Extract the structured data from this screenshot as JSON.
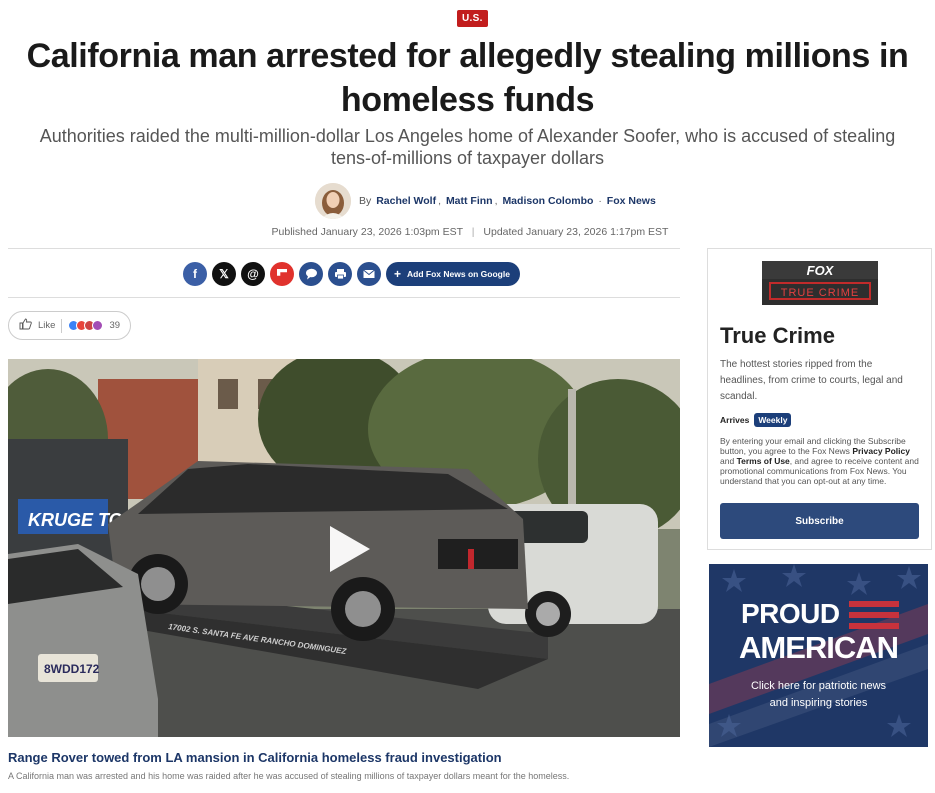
{
  "section_badge": "U.S.",
  "article": {
    "headline": "California man arrested for allegedly stealing millions in homeless funds",
    "subhead": "Authorities raided the multi-million-dollar Los Angeles home of Alexander Soofer, who is accused of stealing tens-of-millions of taxpayer dollars",
    "byline": {
      "by": "By",
      "authors": [
        "Rachel Wolf",
        "Matt Finn",
        "Madison Colombo"
      ],
      "outlet": "Fox News"
    },
    "published": "Published January 23, 2026 1:03pm EST",
    "separator": "|",
    "updated": "Updated January 23, 2026 1:17pm EST"
  },
  "share": {
    "icons": [
      "facebook-icon",
      "x-icon",
      "threads-icon",
      "flipboard-icon",
      "comments-icon",
      "print-icon",
      "email-icon"
    ],
    "add_google": "Add Fox News on Google"
  },
  "reactions": {
    "like_label": "Like",
    "count": "39"
  },
  "video": {
    "truck_text": "KRUGE TOW",
    "plate": "8WDD172",
    "flatbed_text": "17002 S. SANTA FE AVE     RANCHO DOMINGUEZ",
    "caption_title": "Range Rover towed from LA mansion in California homeless fraud investigation",
    "caption_desc": "A California man was arrested and his home was raided after he was accused of stealing millions of taxpayer dollars meant for the homeless."
  },
  "sidebar": {
    "logo_fox": "FOX",
    "logo_sub": "TRUE CRIME",
    "title": "True Crime",
    "description": "The hottest stories ripped from the headlines, from crime to courts, legal and scandal.",
    "arrives_label": "Arrives",
    "arrives_value": "Weekly",
    "legal_1": "By entering your email and clicking the Subscribe button, you agree to the Fox News",
    "legal_privacy": "Privacy Policy",
    "legal_and": "and",
    "legal_terms": "Terms of Use",
    "legal_2": ", and agree to receive content and promotional communications from Fox News. You understand that you can opt-out at any time.",
    "subscribe": "Subscribe"
  },
  "promo": {
    "line1": "PROUD",
    "line2": "AMERICAN",
    "sub1": "Click here for patriotic news",
    "sub2": "and inspiring stories"
  },
  "colors": {
    "accent_navy": "#1c3667",
    "badge_red": "#c21d1d",
    "button_blue": "#2d4a7c"
  }
}
